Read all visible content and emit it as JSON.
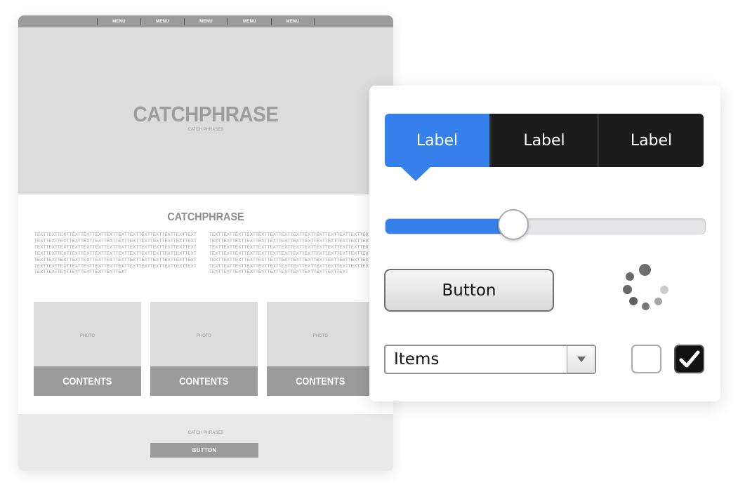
{
  "wireframe": {
    "nav": {
      "items": [
        "MENU",
        "MENU",
        "MENU",
        "MENU",
        "MENU"
      ]
    },
    "hero": {
      "title": "CATCHPHRASE",
      "subtitle": "CATCH PHRASES"
    },
    "section": {
      "title": "CATCHPHRASE",
      "text_left": "TEXTTEXTTEXTTEXTTEXTTEXTTEXTTEXTTEXTTEXTTEXTTEXTTEXTTEXTTEXTTEXTTEXTTEXTTEXTTEXTTEXTTEXTTEXTTEXTTEXTTEXTTEXTTEXTTEXTTEXTTEXTTEXTTEXTTEXTTEXTTEXTTEXTTEXTTEXTTEXTTEXTTEXTTEXTTEXTTEXTTEXTTEXTTEXTTEXTTEXTTEXTTEXTTEXTTEXTTEXTTEXTTEXTTEXTTEXTTEXTTEXTTEXTTEXTTEXTTEXTTEXTTEXTTEXTTEXTTEXTTEXTTEXTTEXTTEXTTEXTTEXTTEXTTEXTTEXTTEXTTEXTTEXTTEXTTEXTTEXTTEXTTEXTTEXTTEXTTEXTTEXTTEXT",
      "text_right": "TEXTTEXTTEXTTEXTTEXTTEXTTEXTTEXTTEXTTEXTTEXTTEXTTEXTTEXTTEXTTEXTTEXTTEXTTEXTTEXTTEXTTEXTTEXTTEXTTEXTTEXTTEXTTEXTTEXTTEXTTEXTTEXTTEXTTEXTTEXTTEXTTEXTTEXTTEXTTEXTTEXTTEXTTEXTTEXTTEXTTEXTTEXTTEXTTEXTTEXTTEXTTEXTTEXTTEXTTEXTTEXTTEXTTEXTTEXTTEXTTEXTTEXTTEXTTEXTTEXTTEXTTEXTTEXTTEXTTEXTTEXTTEXTTEXTTEXTTEXTTEXTTEXTTEXTTEXTTEXTTEXTTEXTTEXTTEXTTEXTTEXTTEXTTEXTTEXTTEXTTEXTTEXTTEXTTEXTTEXTTEXT"
    },
    "cards": [
      {
        "photo": "PHOTO",
        "label": "CONTENTS"
      },
      {
        "photo": "PHOTO",
        "label": "CONTENTS"
      },
      {
        "photo": "PHOTO",
        "label": "CONTENTS"
      }
    ],
    "footer": {
      "subtitle": "CATCH PHRASES",
      "button": "BUTTON"
    }
  },
  "ui_kit": {
    "segmented": {
      "items": [
        "Label",
        "Label",
        "Label"
      ],
      "selected_index": 0,
      "active_color": "#3580ea",
      "inactive_color": "#1c1c1c"
    },
    "slider": {
      "value_fraction": 0.4
    },
    "button": {
      "label": "Button"
    },
    "spinner": {
      "icon": "loading-spinner-icon"
    },
    "select": {
      "value": "Items"
    },
    "checkboxes": [
      {
        "checked": false
      },
      {
        "checked": true,
        "icon": "check-icon"
      }
    ]
  }
}
